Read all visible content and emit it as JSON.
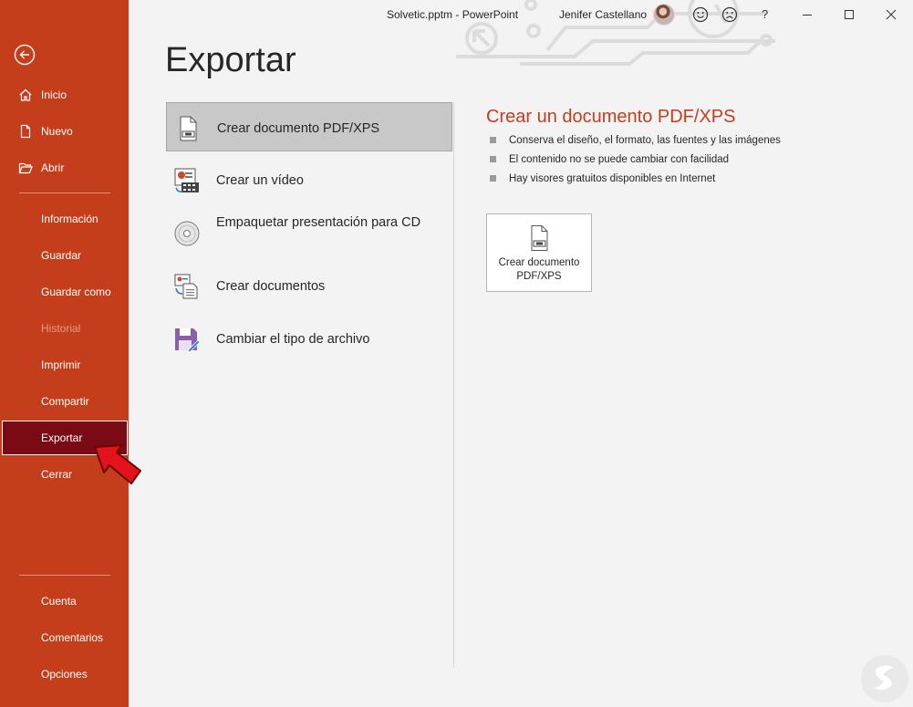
{
  "window": {
    "doc_title": "Solvetic.pptm  -  PowerPoint",
    "user_name": "Jenifer Castellano",
    "help_label": "?"
  },
  "sidebar": {
    "items": [
      {
        "label": "Inicio",
        "icon": "home-icon"
      },
      {
        "label": "Nuevo",
        "icon": "new-document-icon"
      },
      {
        "label": "Abrir",
        "icon": "open-folder-icon"
      },
      {
        "label": "Información"
      },
      {
        "label": "Guardar"
      },
      {
        "label": "Guardar como"
      },
      {
        "label": "Historial",
        "disabled": true
      },
      {
        "label": "Imprimir"
      },
      {
        "label": "Compartir"
      },
      {
        "label": "Exportar",
        "selected": true
      },
      {
        "label": "Cerrar"
      },
      {
        "label": "Cuenta"
      },
      {
        "label": "Comentarios"
      },
      {
        "label": "Opciones"
      }
    ]
  },
  "main": {
    "title": "Exportar",
    "options": [
      {
        "label": "Crear documento PDF/XPS",
        "icon": "pdf-xps-icon",
        "selected": true
      },
      {
        "label": "Crear un vídeo",
        "icon": "video-icon"
      },
      {
        "label": "Empaquetar presentación para CD",
        "icon": "cd-icon"
      },
      {
        "label": "Crear documentos",
        "icon": "handouts-icon"
      },
      {
        "label": "Cambiar el tipo de archivo",
        "icon": "change-file-type-icon"
      }
    ],
    "detail": {
      "title": "Crear un documento PDF/XPS",
      "bullets": [
        "Conserva el diseño, el formato, las fuentes y las imágenes",
        "El contenido no se puede cambiar con facilidad",
        "Hay visores gratuitos disponibles en Internet"
      ],
      "button_line1": "Crear documento",
      "button_line2": "PDF/XPS"
    }
  },
  "colors": {
    "sidebar": "#c43e1c",
    "selected_nav": "#7a0b15",
    "accent_title": "#c43e1c"
  }
}
